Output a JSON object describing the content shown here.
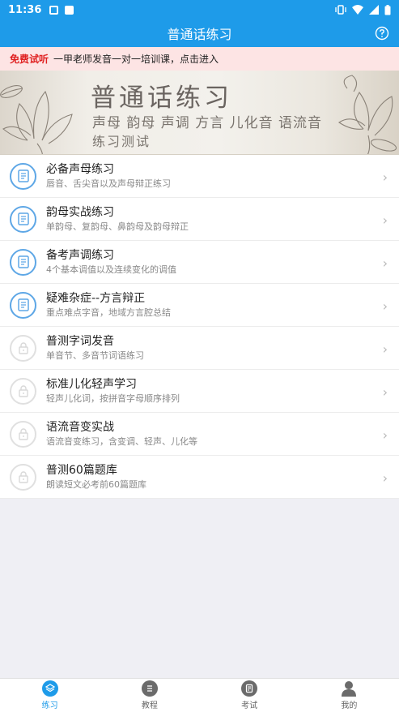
{
  "status_bar": {
    "time": "11:36"
  },
  "app_bar": {
    "title": "普通话练习",
    "help_icon": "question-circle-icon"
  },
  "notice": {
    "tag": "免费试听",
    "text": "一甲老师发音一对一培训课，点击进入"
  },
  "banner": {
    "title": "普通话练习",
    "subtitle_line1": "声母 韵母 声调 方言 儿化音 语流音",
    "subtitle_line2": "练习测试"
  },
  "lessons": [
    {
      "title": "必备声母练习",
      "desc": "唇音、舌尖音以及声母辩正练习",
      "icon": "book-icon",
      "locked": false
    },
    {
      "title": "韵母实战练习",
      "desc": "单韵母、复韵母、鼻韵母及韵母辩正",
      "icon": "book-icon",
      "locked": false
    },
    {
      "title": "备考声调练习",
      "desc": "4个基本调值以及连续变化的调值",
      "icon": "book-icon",
      "locked": false
    },
    {
      "title": "疑难杂症--方言辩正",
      "desc": "重点难点字音，地域方言腔总结",
      "icon": "book-icon",
      "locked": false
    },
    {
      "title": "普测字词发音",
      "desc": "单音节、多音节词语练习",
      "icon": "lock-icon",
      "locked": true
    },
    {
      "title": "标准儿化轻声学习",
      "desc": "轻声儿化词，按拼音字母顺序排列",
      "icon": "lock-icon",
      "locked": true
    },
    {
      "title": "语流音变实战",
      "desc": "语流音变练习，含变调、轻声、儿化等",
      "icon": "lock-icon",
      "locked": true
    },
    {
      "title": "普测60篇题库",
      "desc": "朗读短文必考前60篇题库",
      "icon": "lock-icon",
      "locked": true
    }
  ],
  "tabs": [
    {
      "label": "练习",
      "icon": "layers-icon",
      "active": true
    },
    {
      "label": "教程",
      "icon": "list-icon",
      "active": false
    },
    {
      "label": "考试",
      "icon": "document-icon",
      "active": false
    },
    {
      "label": "我的",
      "icon": "person-icon",
      "active": false
    }
  ],
  "colors": {
    "primary": "#1e9be9",
    "notice_bg": "#fde4e4",
    "notice_tag": "#e02020"
  }
}
